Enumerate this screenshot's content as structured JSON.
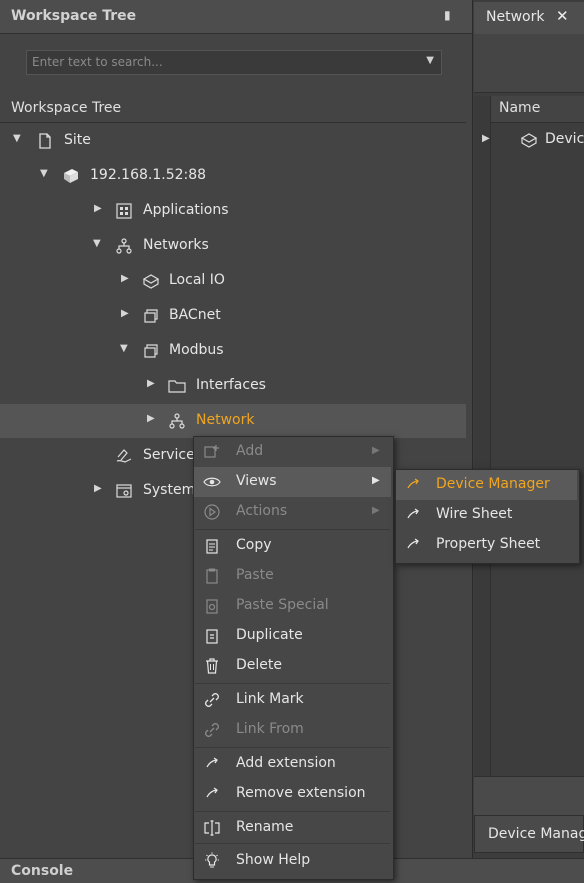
{
  "left_panel": {
    "title": "Workspace Tree",
    "search_placeholder": "Enter text to search...",
    "column_header": "Workspace Tree"
  },
  "tree": {
    "site": "Site",
    "ip": "192.168.1.52:88",
    "applications": "Applications",
    "networks": "Networks",
    "local_io": "Local IO",
    "bacnet": "BACnet",
    "modbus": "Modbus",
    "interfaces": "Interfaces",
    "network": "Network",
    "services": "Services",
    "system": "System"
  },
  "right_panel": {
    "tab_label": "Network",
    "column_name": "Name",
    "row_label": "Device",
    "bottom_tab": "Device Manager"
  },
  "console": {
    "label": "Console"
  },
  "context_menu": {
    "add": "Add",
    "views": "Views",
    "actions": "Actions",
    "copy": "Copy",
    "paste": "Paste",
    "paste_special": "Paste Special",
    "duplicate": "Duplicate",
    "delete": "Delete",
    "link_mark": "Link Mark",
    "link_from": "Link From",
    "add_extension": "Add extension",
    "remove_extension": "Remove extension",
    "rename": "Rename",
    "show_help": "Show Help"
  },
  "views_submenu": {
    "device_manager": "Device Manager",
    "wire_sheet": "Wire Sheet",
    "property_sheet": "Property Sheet"
  },
  "colors": {
    "accent": "#f0a520",
    "panel": "#444444",
    "menu": "#474747"
  }
}
